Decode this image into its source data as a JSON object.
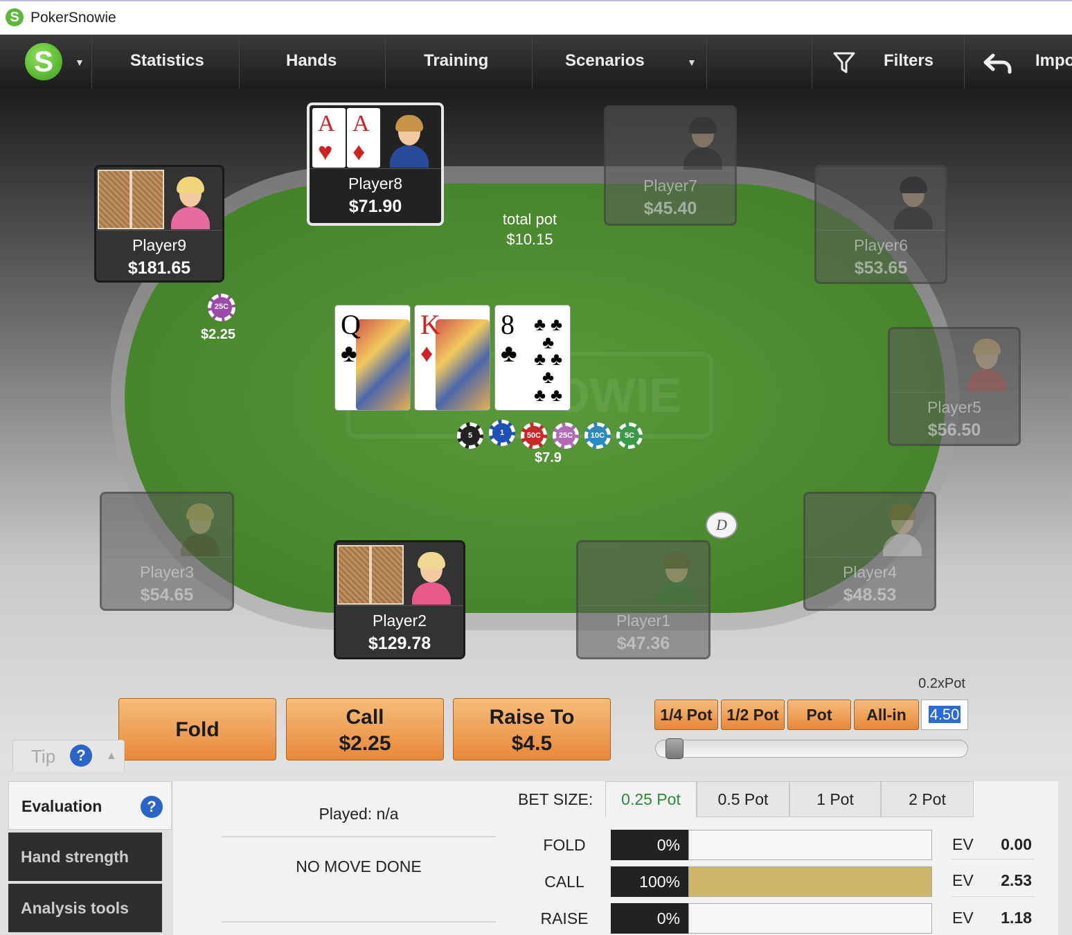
{
  "window": {
    "title": "PokerSnowie",
    "logo_letter": "S"
  },
  "menu": {
    "logo_letter": "S",
    "items": [
      "Statistics",
      "Hands",
      "Training",
      "Scenarios"
    ],
    "filters_label": "Filters",
    "import_label": "Impo"
  },
  "pot": {
    "label": "total pot",
    "amount": "$10.15",
    "center_chips": [
      "5",
      "1",
      "50C",
      "25C",
      "10C",
      "5C"
    ],
    "center_amount": "$7.9"
  },
  "board": [
    {
      "rank": "Q",
      "suit": "♣",
      "color": "#111"
    },
    {
      "rank": "K",
      "suit": "♦",
      "color": "#d12222"
    },
    {
      "rank": "8",
      "suit": "♣",
      "color": "#111"
    }
  ],
  "players": {
    "p9": {
      "name": "Player9",
      "stack": "$181.65"
    },
    "p8": {
      "name": "Player8",
      "stack": "$71.90",
      "cards": [
        {
          "rank": "A",
          "suit": "♥"
        },
        {
          "rank": "A",
          "suit": "♦"
        }
      ]
    },
    "p7": {
      "name": "Player7",
      "stack": "$45.40"
    },
    "p6": {
      "name": "Player6",
      "stack": "$53.65"
    },
    "p5": {
      "name": "Player5",
      "stack": "$56.50"
    },
    "p4": {
      "name": "Player4",
      "stack": "$48.53"
    },
    "p3": {
      "name": "Player3",
      "stack": "$54.65"
    },
    "p2": {
      "name": "Player2",
      "stack": "$129.78"
    },
    "p1": {
      "name": "Player1",
      "stack": "$47.36"
    }
  },
  "p9_bet": {
    "chip": "25C",
    "amount": "$2.25"
  },
  "dealer": "D",
  "actions": {
    "fold": "Fold",
    "call_label": "Call",
    "call_amount": "$2.25",
    "raise_label": "Raise To",
    "raise_amount": "$4.5"
  },
  "bet_presets": {
    "multiplier": "0.2xPot",
    "buttons": [
      "1/4 Pot",
      "1/2 Pot",
      "Pot",
      "All-in"
    ],
    "input_value": "4.50",
    "slider_fraction": 0.02
  },
  "tip": {
    "label": "Tip",
    "help": "?",
    "arrow": "▲"
  },
  "sidebar": {
    "items": [
      "Evaluation",
      "Hand strength",
      "Analysis tools"
    ],
    "help": "?"
  },
  "evaluation": {
    "played": "Played: n/a",
    "move": "NO MOVE DONE",
    "bet_size_label": "BET SIZE:",
    "bet_tabs": [
      "0.25 Pot",
      "0.5 Pot",
      "1 Pot",
      "2 Pot"
    ],
    "selected_tab": "0.25 Pot",
    "rows": [
      {
        "action": "FOLD",
        "pct": "0%",
        "fraction": 0,
        "ev_label": "EV",
        "ev": "0.00"
      },
      {
        "action": "CALL",
        "pct": "100%",
        "fraction": 1,
        "ev_label": "EV",
        "ev": "2.53"
      },
      {
        "action": "RAISE",
        "pct": "0%",
        "fraction": 0,
        "ev_label": "EV",
        "ev": "1.18"
      }
    ]
  },
  "colors": {
    "felt": "#4a8a2e",
    "action_button": "#f0a050",
    "selected_tab_text": "#2a8a3a",
    "call_bar": "#ceb66a"
  }
}
